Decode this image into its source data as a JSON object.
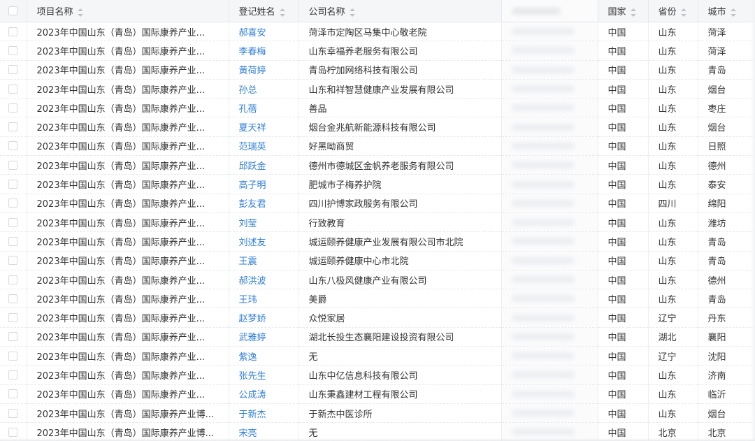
{
  "table": {
    "headers": {
      "project": "项目名称",
      "name": "登记姓名",
      "company": "公司名称",
      "country": "国家",
      "province": "省份",
      "city": "城市"
    },
    "rows": [
      {
        "project": "2023年中国山东（青岛）国际康养产业...",
        "name": "郝喜安",
        "company": "菏泽市定陶区马集中心敬老院",
        "country": "中国",
        "province": "山东",
        "city": "菏泽"
      },
      {
        "project": "2023年中国山东（青岛）国际康养产业...",
        "name": "李春梅",
        "company": "山东幸福养老服务有限公司",
        "country": "中国",
        "province": "山东",
        "city": "菏泽"
      },
      {
        "project": "2023年中国山东（青岛）国际康养产业...",
        "name": "黄荷婷",
        "company": "青岛柠加网络科技有限公司",
        "country": "中国",
        "province": "山东",
        "city": "青岛"
      },
      {
        "project": "2023年中国山东（青岛）国际康养产业...",
        "name": "孙总",
        "company": "山东和祥智慧健康产业发展有限公司",
        "country": "中国",
        "province": "山东",
        "city": "烟台"
      },
      {
        "project": "2023年中国山东（青岛）国际康养产业...",
        "name": "孔蓓",
        "company": "善品",
        "country": "中国",
        "province": "山东",
        "city": "枣庄"
      },
      {
        "project": "2023年中国山东（青岛）国际康养产业...",
        "name": "夏天祥",
        "company": "烟台金兆航新能源科技有限公司",
        "country": "中国",
        "province": "山东",
        "city": "烟台"
      },
      {
        "project": "2023年中国山东（青岛）国际康养产业...",
        "name": "范瑞英",
        "company": "好黑呦商贸",
        "country": "中国",
        "province": "山东",
        "city": "日照"
      },
      {
        "project": "2023年中国山东（青岛）国际康养产业...",
        "name": "邱跃金",
        "company": "德州市德城区金帆养老服务有限公司",
        "country": "中国",
        "province": "山东",
        "city": "德州"
      },
      {
        "project": "2023年中国山东（青岛）国际康养产业...",
        "name": "高子明",
        "company": "肥城市子梅养护院",
        "country": "中国",
        "province": "山东",
        "city": "泰安"
      },
      {
        "project": "2023年中国山东（青岛）国际康养产业...",
        "name": "彭友君",
        "company": "四川护博家政服务有限公司",
        "country": "中国",
        "province": "四川",
        "city": "绵阳"
      },
      {
        "project": "2023年中国山东（青岛）国际康养产业...",
        "name": "刘莹",
        "company": "行致教育",
        "country": "中国",
        "province": "山东",
        "city": "潍坊"
      },
      {
        "project": "2023年中国山东（青岛）国际康养产业...",
        "name": "刘述友",
        "company": "城运颐养健康产业发展有限公司市北院",
        "country": "中国",
        "province": "山东",
        "city": "青岛"
      },
      {
        "project": "2023年中国山东（青岛）国际康养产业...",
        "name": "王震",
        "company": "城运颐养健康中心市北院",
        "country": "中国",
        "province": "山东",
        "city": "青岛"
      },
      {
        "project": "2023年中国山东（青岛）国际康养产业...",
        "name": "郝洪波",
        "company": "山东八极风健康产业有限公司",
        "country": "中国",
        "province": "山东",
        "city": "德州"
      },
      {
        "project": "2023年中国山东（青岛）国际康养产业...",
        "name": "王玮",
        "company": "美爵",
        "country": "中国",
        "province": "山东",
        "city": "青岛"
      },
      {
        "project": "2023年中国山东（青岛）国际康养产业...",
        "name": "赵梦娇",
        "company": "众悦家居",
        "country": "中国",
        "province": "辽宁",
        "city": "丹东"
      },
      {
        "project": "2023年中国山东（青岛）国际康养产业...",
        "name": "武雅婷",
        "company": "湖北长投生态襄阳建设投资有限公司",
        "country": "中国",
        "province": "湖北",
        "city": "襄阳"
      },
      {
        "project": "2023年中国山东（青岛）国际康养产业...",
        "name": "紫逸",
        "company": "无",
        "country": "中国",
        "province": "辽宁",
        "city": "沈阳"
      },
      {
        "project": "2023年中国山东（青岛）国际康养产业...",
        "name": "张先生",
        "company": "山东中亿信息科技有限公司",
        "country": "中国",
        "province": "山东",
        "city": "济南"
      },
      {
        "project": "2023年中国山东（青岛）国际康养产业...",
        "name": "公成涛",
        "company": "山东秉鑫建材工程有限公司",
        "country": "中国",
        "province": "山东",
        "city": "临沂"
      },
      {
        "project": "2023年中国山东（青岛）国际康养产业博...",
        "name": "于新杰",
        "company": "于新杰中医诊所",
        "country": "中国",
        "province": "山东",
        "city": "烟台"
      },
      {
        "project": "2023年中国山东（青岛）国际康养产业博...",
        "name": "宋亮",
        "company": "无",
        "country": "中国",
        "province": "北京",
        "city": "北京"
      }
    ]
  }
}
